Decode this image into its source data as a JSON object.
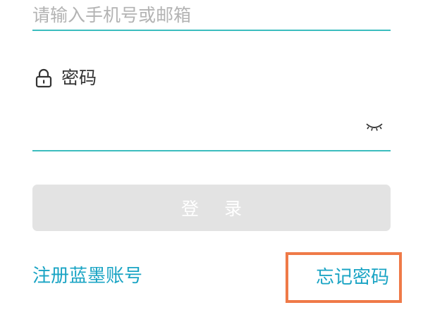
{
  "login_form": {
    "account_placeholder": "请输入手机号或邮箱",
    "account_value": "",
    "password_label": "密码",
    "password_value": "",
    "login_button_label": "登 录",
    "register_link_label": "注册蓝墨账号",
    "forgot_password_label": "忘记密码"
  },
  "icons": {
    "lock": "lock-icon",
    "password_visibility": "eye-closed-icon"
  },
  "colors": {
    "accent_underline": "#3bbdbe",
    "link": "#1aa4c4",
    "login_button_disabled": "#e3e3e3",
    "highlight_box": "#ef7a48"
  }
}
